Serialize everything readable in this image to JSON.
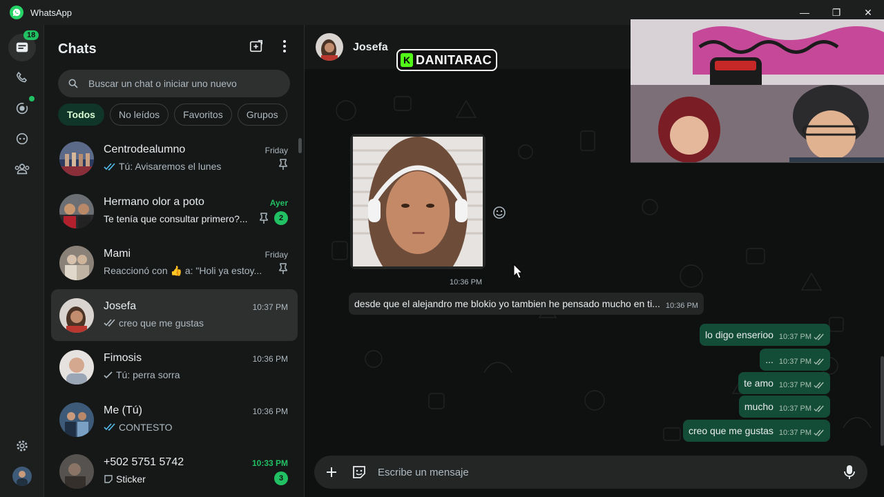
{
  "app": {
    "title": "WhatsApp"
  },
  "window": {
    "minimize": "—",
    "maximize": "❐",
    "close": "✕"
  },
  "rail": {
    "unread_badge": "18"
  },
  "chatlist": {
    "title": "Chats",
    "search_placeholder": "Buscar un chat o iniciar uno nuevo",
    "filters": [
      "Todos",
      "No leídos",
      "Favoritos",
      "Grupos"
    ],
    "items": [
      {
        "name": "Centrodealumno",
        "time": "Friday",
        "preview": "Tú: Avisaremos el lunes",
        "tick": "double-blue",
        "pinned": true,
        "unread": "",
        "time_green": false
      },
      {
        "name": "Hermano olor a poto",
        "time": "Ayer",
        "preview": "Te tenía que consultar primero?...",
        "tick": "",
        "pinned": true,
        "unread": "2",
        "time_green": true
      },
      {
        "name": "Mami",
        "time": "Friday",
        "preview": "Reaccionó con 👍 a: \"Holi ya estoy...",
        "tick": "",
        "pinned": true,
        "unread": "",
        "time_green": false
      },
      {
        "name": "Josefa",
        "time": "10:37 PM",
        "preview": "creo que me gustas",
        "tick": "double-gray",
        "pinned": false,
        "unread": "",
        "time_green": false
      },
      {
        "name": "Fimosis",
        "time": "10:36 PM",
        "preview": "Tú: perra sorra",
        "tick": "single",
        "pinned": false,
        "unread": "",
        "time_green": false
      },
      {
        "name": "Me (Tú)",
        "time": "10:36 PM",
        "preview": "CONTESTO",
        "tick": "double-blue",
        "pinned": false,
        "unread": "",
        "time_green": false
      },
      {
        "name": "+502 5751 5742",
        "time": "10:33 PM",
        "preview": "Sticker",
        "tick": "sticker",
        "pinned": false,
        "unread": "3",
        "time_green": true
      }
    ]
  },
  "conversation": {
    "contact": "Josefa",
    "overlay_text": "DANITARAC",
    "overlay_k": "K",
    "photo_time": "10:36 PM",
    "incoming": {
      "text": "desde que el alejandro me blokio yo tambien he pensado mucho en ti...",
      "time": "10:36 PM"
    },
    "outgoing": [
      {
        "text": "lo digo enserioo",
        "time": "10:37 PM"
      },
      {
        "text": "...",
        "time": "10:37 PM"
      },
      {
        "text": "te amo",
        "time": "10:37 PM"
      },
      {
        "text": "mucho",
        "time": "10:37 PM"
      },
      {
        "text": "creo que me gustas",
        "time": "10:37 PM"
      }
    ],
    "composer_placeholder": "Escribe un mensaje"
  },
  "colors": {
    "accent": "#21c063",
    "outgoing_bubble": "#144d37",
    "incoming_bubble": "#242626",
    "panel": "#161717"
  }
}
